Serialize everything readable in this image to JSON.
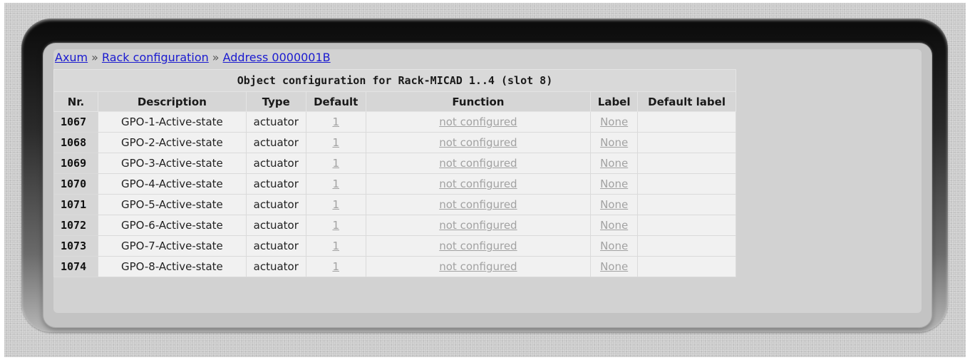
{
  "breadcrumb": {
    "items": [
      "Axum",
      "Rack configuration",
      "Address 0000001B"
    ],
    "separator": "»"
  },
  "table": {
    "caption": "Object configuration for Rack-MICAD 1..4 (slot 8)",
    "columns": [
      "Nr.",
      "Description",
      "Type",
      "Default",
      "Function",
      "Label",
      "Default label"
    ],
    "rows": [
      {
        "nr": "1067",
        "description": "GPO-1-Active-state",
        "type": "actuator",
        "default": "1",
        "function": "not configured",
        "label": "None",
        "default_label": ""
      },
      {
        "nr": "1068",
        "description": "GPO-2-Active-state",
        "type": "actuator",
        "default": "1",
        "function": "not configured",
        "label": "None",
        "default_label": ""
      },
      {
        "nr": "1069",
        "description": "GPO-3-Active-state",
        "type": "actuator",
        "default": "1",
        "function": "not configured",
        "label": "None",
        "default_label": ""
      },
      {
        "nr": "1070",
        "description": "GPO-4-Active-state",
        "type": "actuator",
        "default": "1",
        "function": "not configured",
        "label": "None",
        "default_label": ""
      },
      {
        "nr": "1071",
        "description": "GPO-5-Active-state",
        "type": "actuator",
        "default": "1",
        "function": "not configured",
        "label": "None",
        "default_label": ""
      },
      {
        "nr": "1072",
        "description": "GPO-6-Active-state",
        "type": "actuator",
        "default": "1",
        "function": "not configured",
        "label": "None",
        "default_label": ""
      },
      {
        "nr": "1073",
        "description": "GPO-7-Active-state",
        "type": "actuator",
        "default": "1",
        "function": "not configured",
        "label": "None",
        "default_label": ""
      },
      {
        "nr": "1074",
        "description": "GPO-8-Active-state",
        "type": "actuator",
        "default": "1",
        "function": "not configured",
        "label": "None",
        "default_label": ""
      }
    ]
  },
  "colors": {
    "link": "#1a1ad0",
    "disabled_link": "#a2a2a2",
    "header_bg": "#d6d6d6",
    "cell_bg": "#f1f1f1"
  }
}
